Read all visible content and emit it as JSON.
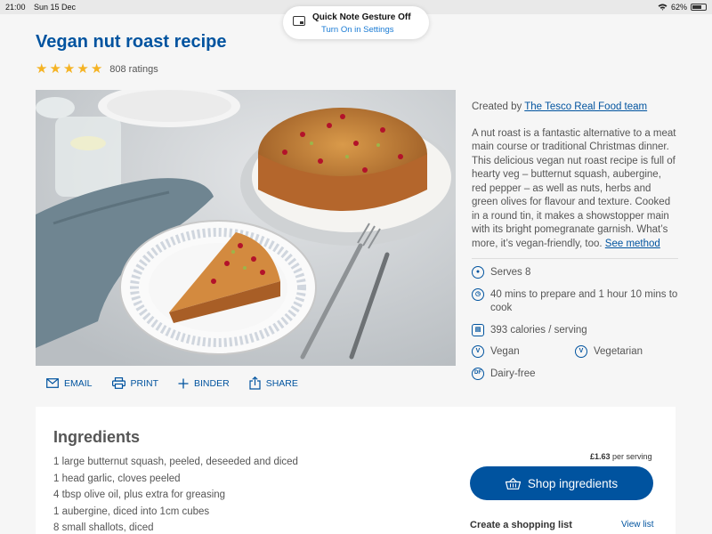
{
  "status_bar": {
    "time": "21:00",
    "date": "Sun 15 Dec",
    "battery": "62%"
  },
  "toast": {
    "title": "Quick Note Gesture Off",
    "action": "Turn On in Settings"
  },
  "recipe": {
    "title": "Vegan nut roast recipe",
    "rating_stars": 5,
    "ratings_count": "808 ratings",
    "created_by_label": "Created by",
    "author": "The Tesco Real Food team",
    "description": "A nut roast is a fantastic alternative to a meat main course or traditional Christmas dinner. This delicious vegan nut roast recipe is full of hearty veg – butternut squash, aubergine, red pepper – as well as nuts, herbs and green olives for flavour and texture. Cooked in a round tin, it makes a showstopper main with its bright pomegranate garnish. What’s more, it’s vegan-friendly, too.",
    "see_method": "See method",
    "serves": "Serves 8",
    "time": "40 mins to prepare and 1 hour 10 mins to cook",
    "calories": "393 calories / serving",
    "tags": [
      {
        "icon": "vegan-icon",
        "label": "Vegan",
        "glyph": "V"
      },
      {
        "icon": "vegetarian-icon",
        "label": "Vegetarian",
        "glyph": "V"
      },
      {
        "icon": "dairy-free-icon",
        "label": "Dairy-free",
        "glyph": "DF"
      }
    ]
  },
  "actions": {
    "email": "EMAIL",
    "print": "PRINT",
    "binder": "BINDER",
    "share": "SHARE"
  },
  "ingredients": {
    "heading": "Ingredients",
    "items": [
      "1 large butternut squash, peeled, deseeded and diced",
      "1 head garlic, cloves peeled",
      "4 tbsp olive oil, plus extra for greasing",
      "1 aubergine, diced into 1cm cubes",
      "8 small shallots, diced"
    ],
    "price": "£1.63",
    "price_suffix": "per serving",
    "shop_button": "Shop ingredients",
    "create_list": "Create a shopping list",
    "view_list": "View list"
  },
  "colors": {
    "brand_blue": "#00539f",
    "star": "#f5b323"
  }
}
